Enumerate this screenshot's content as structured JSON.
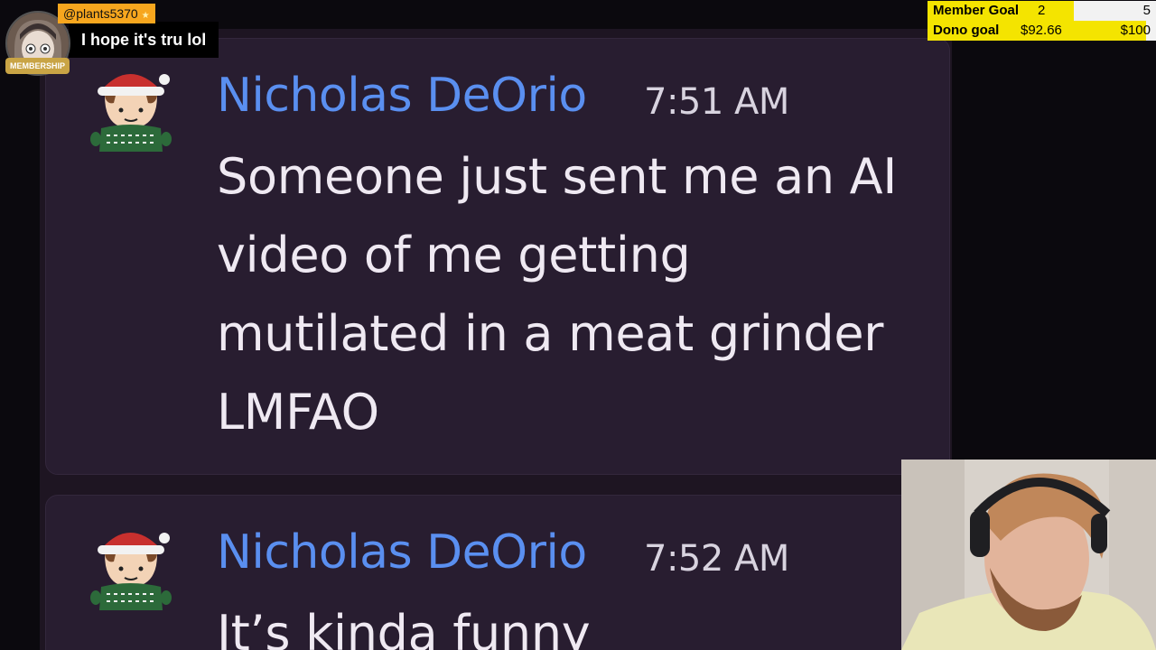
{
  "chat_overlay": {
    "username": "@plants5370",
    "message": "I hope it's tru lol",
    "badge": "MEMBERSHIP"
  },
  "goals": {
    "member": {
      "label": "Member Goal",
      "current": "2",
      "target": "5",
      "progress": 0.4
    },
    "dono": {
      "label": "Dono goal",
      "current": "$92.66",
      "target": "$100",
      "progress": 0.9266
    }
  },
  "messages": [
    {
      "author": "Nicholas DeOrio",
      "time": "7:51 AM",
      "lines": [
        "Someone just sent me an AI",
        "video of me getting",
        "mutilated in a meat grinder",
        "LMFAO"
      ]
    },
    {
      "author": "Nicholas DeOrio",
      "time": "7:52 AM",
      "lines": [
        "It’s kinda funny"
      ]
    }
  ],
  "colors": {
    "author": "#5a8ff0",
    "card_bg": "#281d30",
    "goal_yellow": "#f4e400",
    "chat_username_bg": "#f7a61e"
  }
}
